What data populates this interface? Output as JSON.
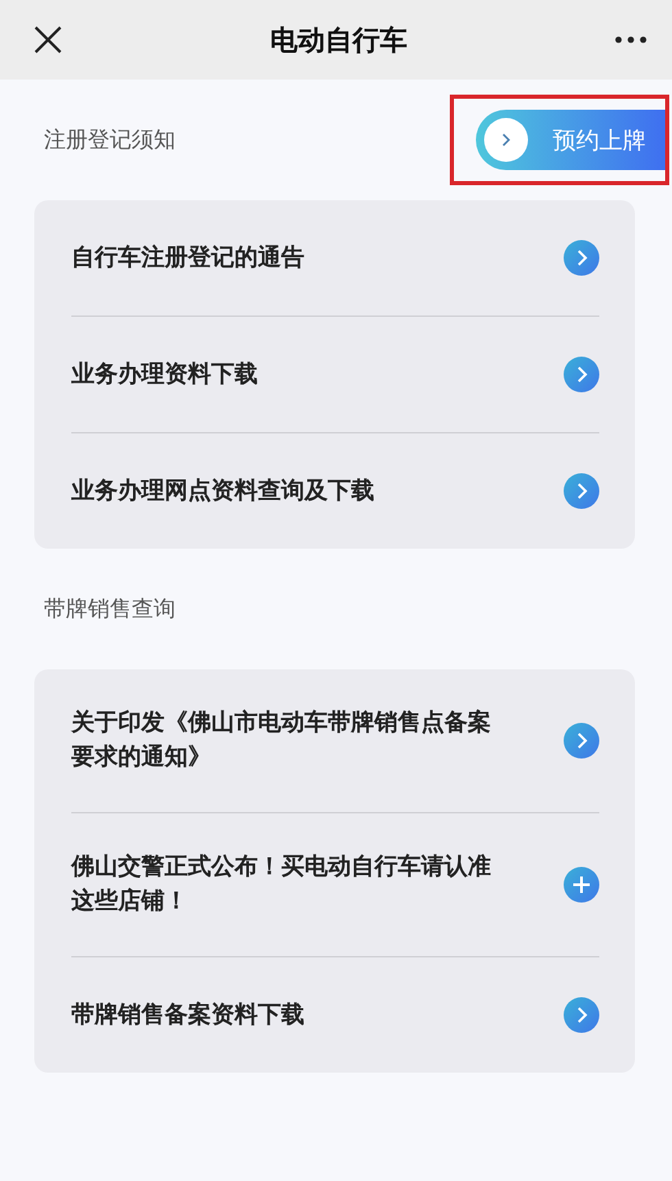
{
  "header": {
    "title": "电动自行车"
  },
  "sections": [
    {
      "title": "注册登记须知",
      "action": {
        "label": "预约上牌"
      },
      "items": [
        {
          "text": "自行车注册登记的通告",
          "kind": "arrow"
        },
        {
          "text": "业务办理资料下载",
          "kind": "arrow"
        },
        {
          "text": "业务办理网点资料查询及下载",
          "kind": "arrow"
        }
      ]
    },
    {
      "title": "带牌销售查询",
      "items": [
        {
          "text": "关于印发《佛山市电动车带牌销售点备案要求的通知》",
          "kind": "arrow"
        },
        {
          "text": "佛山交警正式公布！买电动自行车请认准这些店铺！",
          "kind": "plus"
        },
        {
          "text": "带牌销售备案资料下载",
          "kind": "arrow"
        }
      ]
    }
  ]
}
